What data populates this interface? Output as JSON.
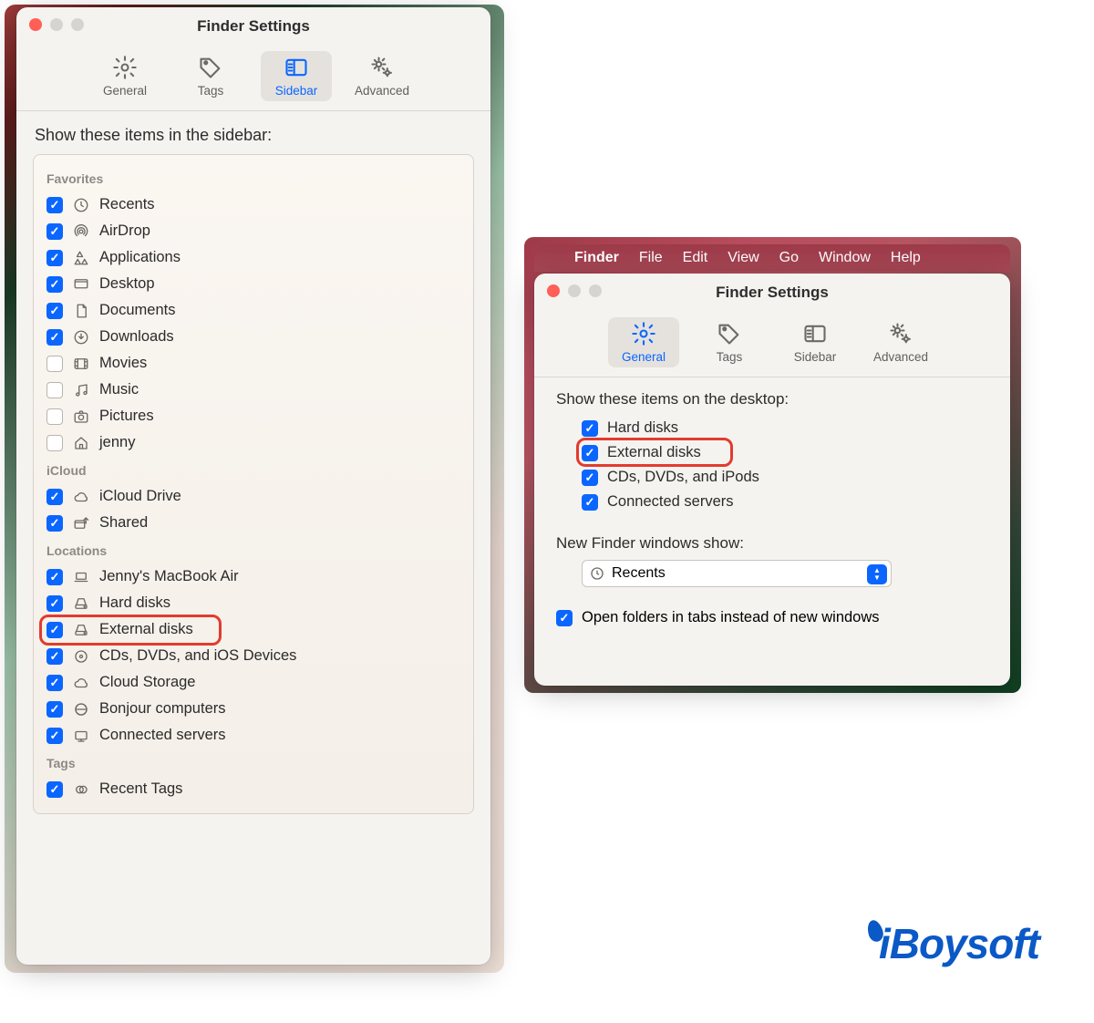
{
  "menubar": {
    "app": "Finder",
    "items": [
      "File",
      "Edit",
      "View",
      "Go",
      "Window",
      "Help"
    ]
  },
  "leftWindow": {
    "title": "Finder Settings",
    "tabs": [
      {
        "id": "general",
        "label": "General",
        "icon": "gear",
        "selected": false
      },
      {
        "id": "tags",
        "label": "Tags",
        "icon": "tag",
        "selected": false
      },
      {
        "id": "sidebar",
        "label": "Sidebar",
        "icon": "sidebar",
        "selected": true
      },
      {
        "id": "advanced",
        "label": "Advanced",
        "icon": "gears",
        "selected": false
      }
    ],
    "heading": "Show these items in the sidebar:",
    "groups": [
      {
        "label": "Favorites",
        "items": [
          {
            "checked": true,
            "icon": "clock",
            "label": "Recents"
          },
          {
            "checked": true,
            "icon": "airdrop",
            "label": "AirDrop"
          },
          {
            "checked": true,
            "icon": "app",
            "label": "Applications"
          },
          {
            "checked": true,
            "icon": "desktop",
            "label": "Desktop"
          },
          {
            "checked": true,
            "icon": "doc",
            "label": "Documents"
          },
          {
            "checked": true,
            "icon": "download",
            "label": "Downloads"
          },
          {
            "checked": false,
            "icon": "movie",
            "label": "Movies"
          },
          {
            "checked": false,
            "icon": "music",
            "label": "Music"
          },
          {
            "checked": false,
            "icon": "camera",
            "label": "Pictures"
          },
          {
            "checked": false,
            "icon": "home",
            "label": "jenny"
          }
        ]
      },
      {
        "label": "iCloud",
        "items": [
          {
            "checked": true,
            "icon": "cloud",
            "label": "iCloud Drive"
          },
          {
            "checked": true,
            "icon": "shared",
            "label": "Shared"
          }
        ]
      },
      {
        "label": "Locations",
        "items": [
          {
            "checked": true,
            "icon": "laptop",
            "label": "Jenny's MacBook Air"
          },
          {
            "checked": true,
            "icon": "disk",
            "label": "Hard disks"
          },
          {
            "checked": true,
            "icon": "disk",
            "label": "External disks",
            "highlight": true
          },
          {
            "checked": true,
            "icon": "cd",
            "label": "CDs, DVDs, and iOS Devices"
          },
          {
            "checked": true,
            "icon": "cloud",
            "label": "Cloud Storage"
          },
          {
            "checked": true,
            "icon": "bonjour",
            "label": "Bonjour computers"
          },
          {
            "checked": true,
            "icon": "server",
            "label": "Connected servers"
          }
        ]
      },
      {
        "label": "Tags",
        "items": [
          {
            "checked": true,
            "icon": "tagcircle",
            "label": "Recent Tags"
          }
        ]
      }
    ]
  },
  "rightWindow": {
    "title": "Finder Settings",
    "tabs": [
      {
        "id": "general",
        "label": "General",
        "icon": "gear",
        "selected": true
      },
      {
        "id": "tags",
        "label": "Tags",
        "icon": "tag",
        "selected": false
      },
      {
        "id": "sidebar",
        "label": "Sidebar",
        "icon": "sidebar",
        "selected": false
      },
      {
        "id": "advanced",
        "label": "Advanced",
        "icon": "gears",
        "selected": false
      }
    ],
    "heading": "Show these items on the desktop:",
    "items": [
      {
        "checked": true,
        "label": "Hard disks"
      },
      {
        "checked": true,
        "label": "External disks",
        "highlight": true
      },
      {
        "checked": true,
        "label": "CDs, DVDs, and iPods"
      },
      {
        "checked": true,
        "label": "Connected servers"
      }
    ],
    "newWindowsLabel": "New Finder windows show:",
    "newWindowsValue": "Recents",
    "footerChecked": true,
    "footerLabel": "Open folders in tabs instead of new windows"
  },
  "logo": "iBoysoft"
}
